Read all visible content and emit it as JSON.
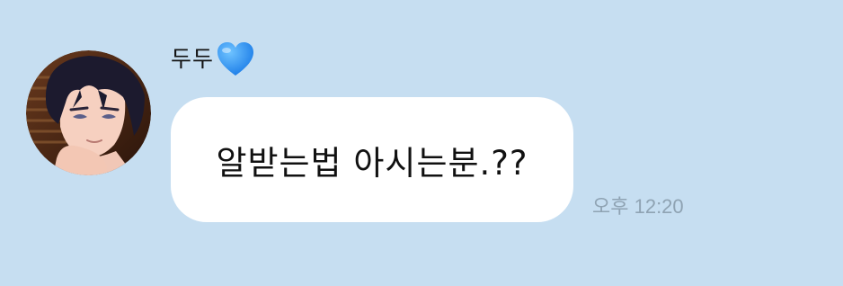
{
  "chat": {
    "sender_name": "두두",
    "sender_emoji_icon": "blue-heart-icon",
    "message_text": "알받는법 아시는분.??",
    "timestamp": "오후 12:20"
  },
  "colors": {
    "background": "#c6def1",
    "bubble": "#ffffff",
    "text": "#111111",
    "timestamp": "#8fa3b3",
    "heart": "#1e90ff"
  }
}
